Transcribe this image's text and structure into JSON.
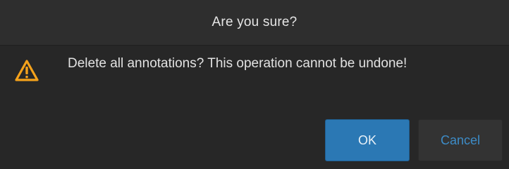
{
  "dialog": {
    "title": "Are you sure?",
    "message": "Delete all annotations? This operation cannot be undone!",
    "icon": "warning-icon",
    "ok_label": "OK",
    "cancel_label": "Cancel"
  },
  "colors": {
    "background": "#272727",
    "titlebar": "#2e2e2e",
    "ok_button": "#2b78b4",
    "cancel_text": "#3d8cc7",
    "warning_icon": "#f5a21b"
  }
}
